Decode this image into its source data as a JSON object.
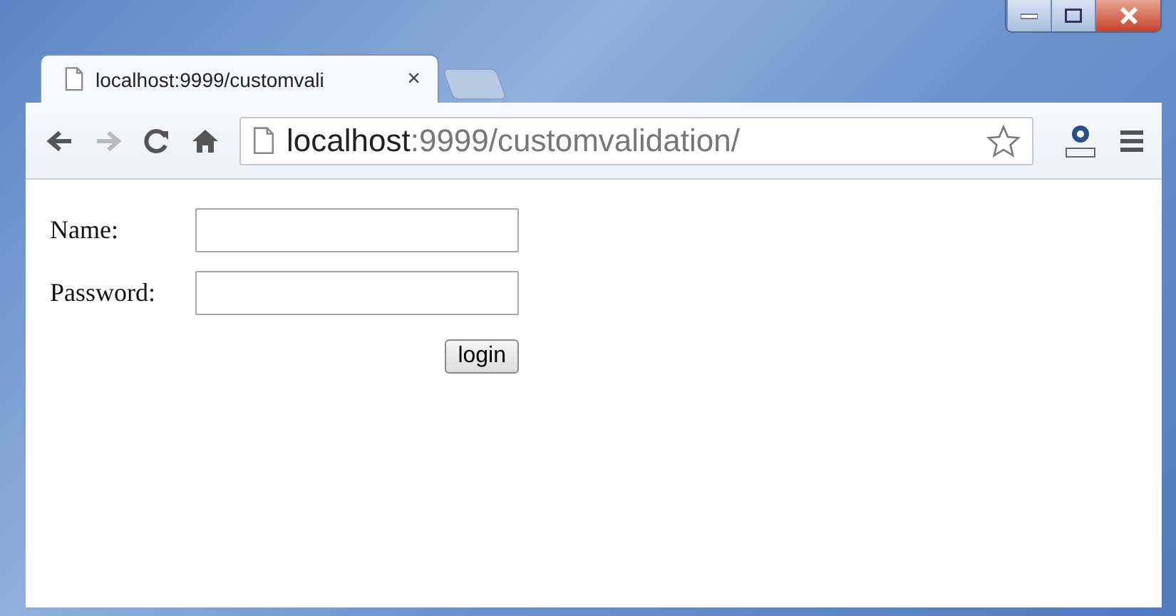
{
  "window": {
    "controls": [
      {
        "kind": "minimize"
      },
      {
        "kind": "maximize"
      },
      {
        "kind": "close"
      }
    ]
  },
  "tabs": [
    {
      "title": "localhost:9999/customvali",
      "close": "×",
      "selected": true
    }
  ],
  "address": {
    "host": "localhost",
    "rest": ":9999/customvalidation/"
  },
  "form": {
    "fields": [
      {
        "label": "Name:"
      },
      {
        "label": "Password:"
      }
    ],
    "button": "login"
  }
}
